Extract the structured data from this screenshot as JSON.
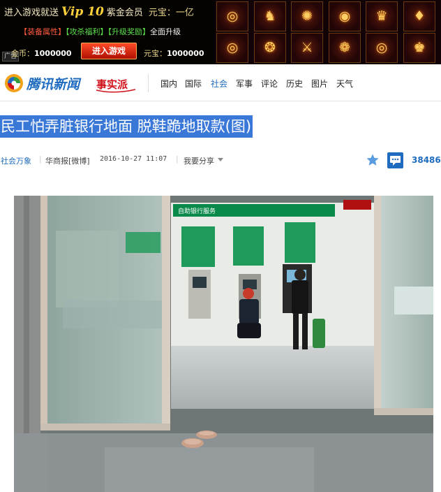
{
  "ad": {
    "line1_prefix": "进入游戏就送",
    "vip": "Vip 10",
    "line1_suffix": "紫金会员",
    "yuanbao_partial": "元宝：一亿",
    "line2": [
      "【装备属性】",
      "【攻杀福利】",
      "【升级奖励】",
      "全面升级"
    ],
    "tag": "广告",
    "gold_label": "金币：",
    "gold_value": "1000000",
    "enter_button": "进入游戏",
    "yuanbao_label": "元宝：",
    "yuanbao_value": "1000000",
    "item_icons": [
      "ring-icon",
      "mount-icon",
      "dragon-icon",
      "bracelet-icon",
      "boots-icon",
      "torch-icon",
      "ring-icon",
      "necklace-icon",
      "sword-icon",
      "chain-icon",
      "ring-icon",
      "crown-icon"
    ]
  },
  "nav": {
    "brand": "腾讯新闻",
    "sub_brand": "事实派",
    "items": [
      {
        "label": "国内",
        "active": false
      },
      {
        "label": "国际",
        "active": false
      },
      {
        "label": "社会",
        "active": true
      },
      {
        "label": "军事",
        "active": false
      },
      {
        "label": "评论",
        "active": false
      },
      {
        "label": "历史",
        "active": false
      },
      {
        "label": "图片",
        "active": false
      },
      {
        "label": "天气",
        "active": false
      }
    ]
  },
  "article": {
    "title": "民工怕弄脏银行地面 脱鞋跪地取款(图)",
    "category": "社会万象",
    "source": "华商报[微博]",
    "datetime": "2016-10-27 11:07",
    "share": "我要分享",
    "comment_count": "38486"
  },
  "photo": {
    "bank_sign": "自助银行服务"
  },
  "colors": {
    "accent": "#1e6bbf",
    "title_highlight": "#3a78d8",
    "brand_red": "#d0101a",
    "bank_green": "#0a8a4a"
  }
}
